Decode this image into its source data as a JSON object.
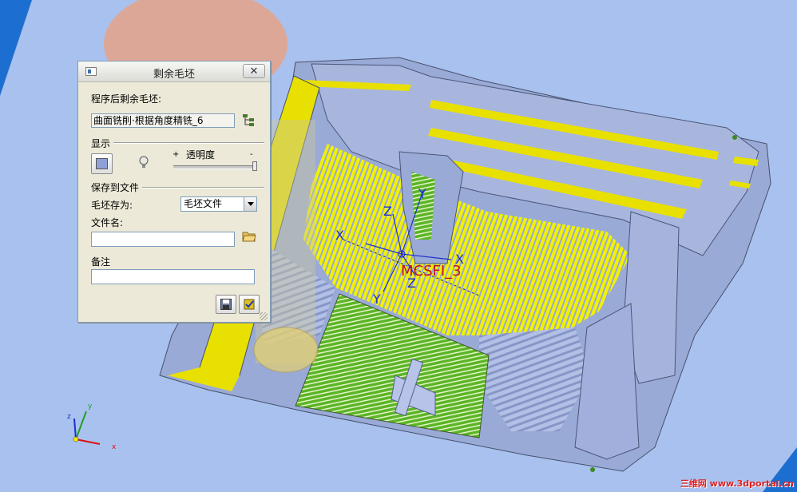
{
  "dialog": {
    "title": "剩余毛坯",
    "close_label": "✕",
    "program_after_label": "程序后剩余毛坯:",
    "program_after_value": "曲面铣削·根据角度精铣_6",
    "display_group": "显示",
    "transparency_plus": "+",
    "transparency_label": "透明度",
    "transparency_minus": "-",
    "transparency_level": 1.0,
    "save_group": "保存到文件",
    "save_as_label": "毛坯存为:",
    "save_as_value": "毛坯文件",
    "filename_label": "文件名:",
    "filename_value": "",
    "note_label": "备注",
    "note_value": ""
  },
  "viewport": {
    "coord_label": "MCSFI_3",
    "axes": {
      "x": "X",
      "y": "Y",
      "z": "Z"
    },
    "triad_axes": {
      "x": "x",
      "y": "y",
      "z": "z"
    }
  },
  "watermark": "三维网 www.3dportal.cn",
  "colors": {
    "background": "#a9c1ee",
    "model": "#9aaad6",
    "toolpath": "#f0f000",
    "finish": "#66c02a",
    "axis_blue": "#1f2fd0",
    "label_red": "#c0102a"
  }
}
